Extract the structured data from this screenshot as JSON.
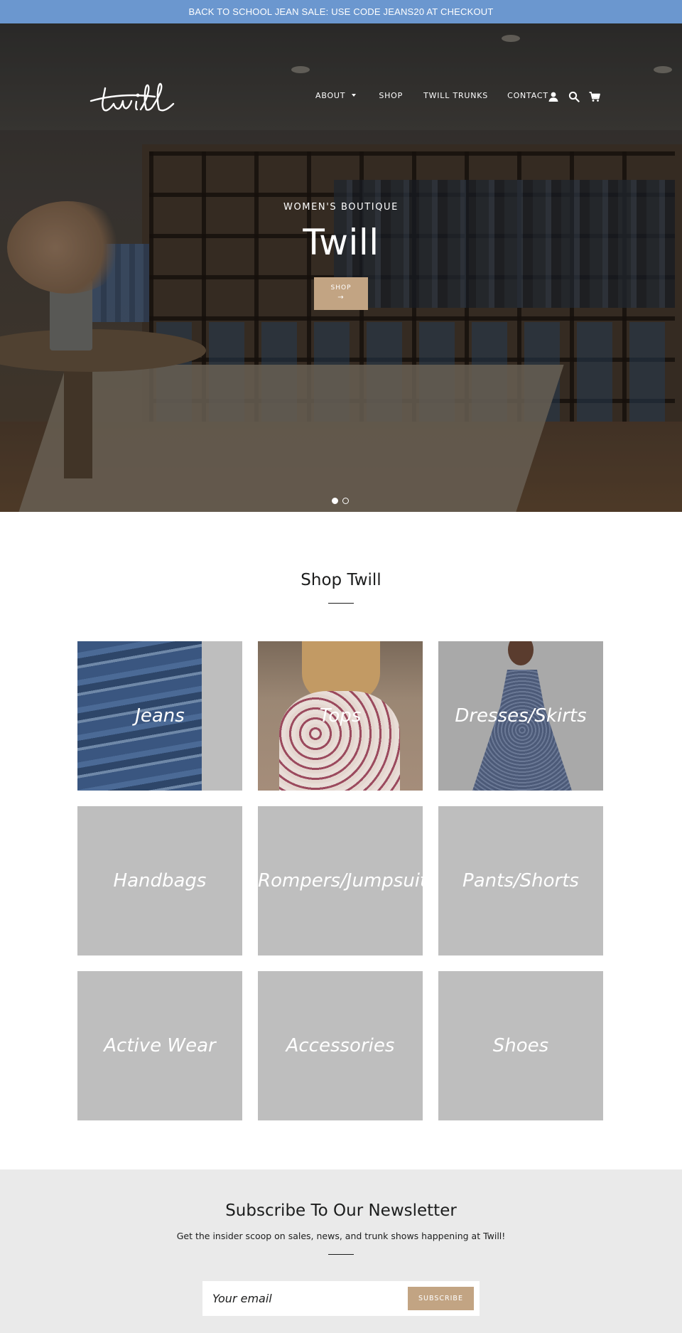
{
  "announcement": {
    "text": "BACK TO SCHOOL JEAN SALE: USE CODE JEANS20 AT CHECKOUT"
  },
  "header": {
    "logo_text": "twill",
    "nav": {
      "about": "ABOUT",
      "shop": "SHOP",
      "twill_trunks": "TWILL TRUNKS",
      "contact": "CONTACT"
    },
    "icons": [
      "account-icon",
      "search-icon",
      "cart-icon"
    ]
  },
  "hero": {
    "subtitle": "WOMEN'S BOUTIQUE",
    "title": "Twill",
    "button_label": "SHOP",
    "button_arrow": "→",
    "slides_count": 2,
    "active_slide": 1
  },
  "collections": {
    "title": "Shop Twill",
    "items": [
      {
        "label": "Jeans"
      },
      {
        "label": "Tops"
      },
      {
        "label": "Dresses/Skirts"
      },
      {
        "label": "Handbags"
      },
      {
        "label": "Rompers/Jumpsuits"
      },
      {
        "label": "Pants/Shorts"
      },
      {
        "label": "Active Wear"
      },
      {
        "label": "Accessories"
      },
      {
        "label": "Shoes"
      }
    ]
  },
  "newsletter": {
    "title": "Subscribe To Our Newsletter",
    "subtitle": "Get the insider scoop on sales, news, and trunk shows happening at Twill!",
    "email_placeholder": "Your email",
    "button_label": "SUBSCRIBE"
  },
  "colors": {
    "announcement_bg": "#6b97cf",
    "accent": "#c2a483",
    "tile_bg": "#bebebe",
    "newsletter_bg": "#eaeaea"
  }
}
